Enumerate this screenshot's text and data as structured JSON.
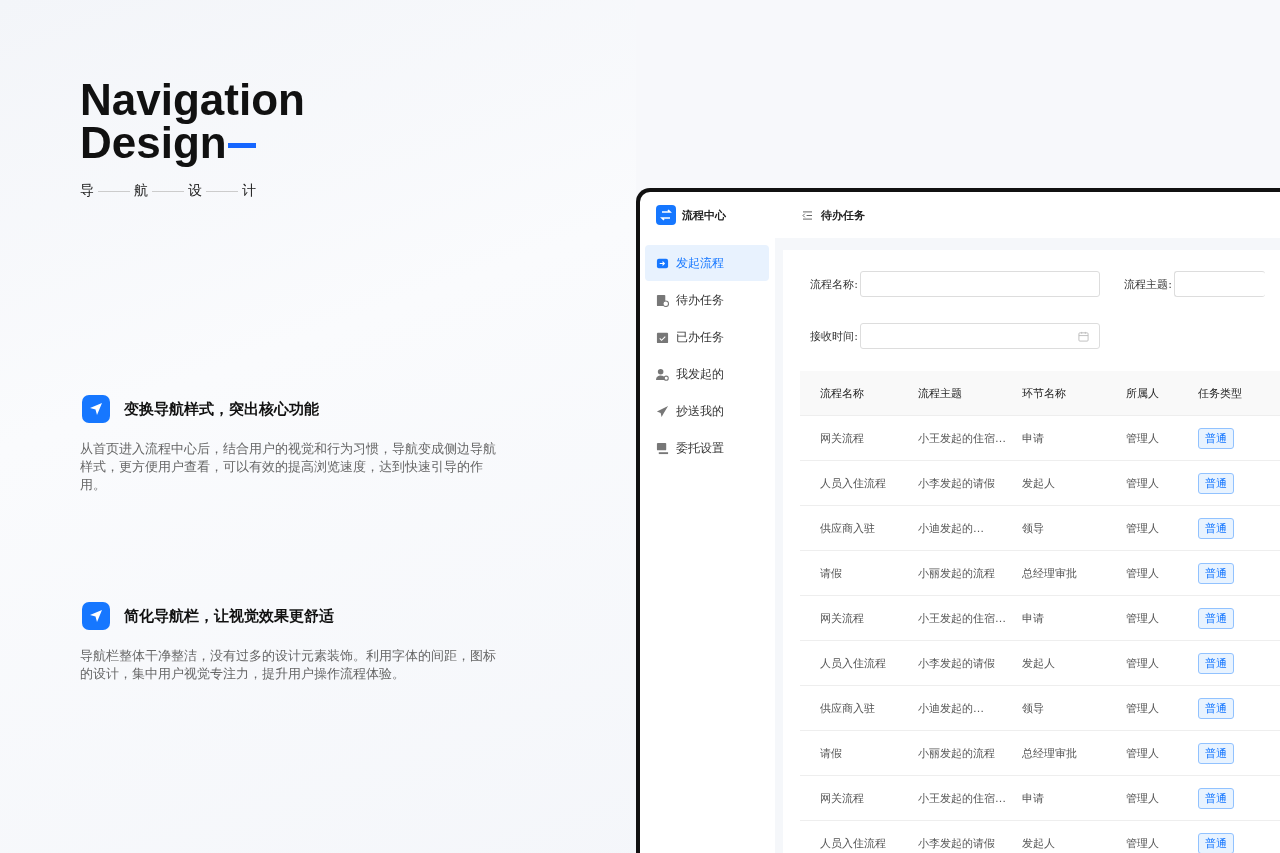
{
  "hero": {
    "title_lines": [
      "Navigation",
      "Design"
    ],
    "subtitle_chars": [
      "导",
      "航",
      "设",
      "计"
    ]
  },
  "features": [
    {
      "heading": "变换导航样式，突出核心功能",
      "text": "从首页进入流程中心后，结合用户的视觉和行为习惯，导航变成侧边导航样式，更方便用户查看，可以有效的提高浏览速度，达到快速引导的作用。"
    },
    {
      "heading": "简化导航栏，让视觉效果更舒适",
      "text": "导航栏整体干净整洁，没有过多的设计元素装饰。利用字体的间距，图标的设计，集中用户视觉专注力，提升用户操作流程体验。"
    }
  ],
  "app": {
    "logo_title": "流程中心",
    "page_title": "待办任务",
    "sidebar": {
      "items": [
        {
          "label": "发起流程",
          "kind": "start",
          "selected": true
        },
        {
          "label": "待办任务",
          "kind": "todo",
          "selected": false
        },
        {
          "label": "已办任务",
          "kind": "done",
          "selected": false
        },
        {
          "label": "我发起的",
          "kind": "mine",
          "selected": false
        },
        {
          "label": "抄送我的",
          "kind": "cc",
          "selected": false
        },
        {
          "label": "委托设置",
          "kind": "delegate",
          "selected": false
        }
      ]
    },
    "filters": [
      {
        "label": "流程名称:",
        "kind": "text"
      },
      {
        "label": "流程主题:",
        "kind": "text"
      },
      {
        "label": "接收时间:",
        "kind": "date"
      }
    ],
    "table": {
      "columns": [
        "流程名称",
        "流程主题",
        "环节名称",
        "所属人",
        "任务类型"
      ],
      "rows": [
        [
          "网关流程",
          "小王发起的住宿…",
          "申请",
          "管理人",
          "普通"
        ],
        [
          "人员入住流程",
          "小李发起的请假",
          "发起人",
          "管理人",
          "普通"
        ],
        [
          "供应商入驻",
          "小迪发起的…",
          "领导",
          "管理人",
          "普通"
        ],
        [
          "请假",
          "小丽发起的流程",
          "总经理审批",
          "管理人",
          "普通"
        ],
        [
          "网关流程",
          "小王发起的住宿…",
          "申请",
          "管理人",
          "普通"
        ],
        [
          "人员入住流程",
          "小李发起的请假",
          "发起人",
          "管理人",
          "普通"
        ],
        [
          "供应商入驻",
          "小迪发起的…",
          "领导",
          "管理人",
          "普通"
        ],
        [
          "请假",
          "小丽发起的流程",
          "总经理审批",
          "管理人",
          "普通"
        ],
        [
          "网关流程",
          "小王发起的住宿…",
          "申请",
          "管理人",
          "普通"
        ],
        [
          "人员入住流程",
          "小李发起的请假",
          "发起人",
          "管理人",
          "普通"
        ]
      ]
    }
  }
}
